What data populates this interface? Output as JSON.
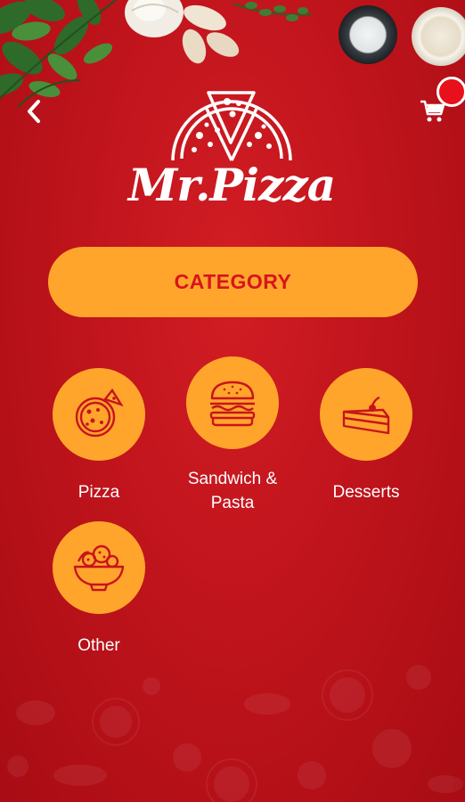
{
  "app": {
    "logo_text": "Mr.Pizza"
  },
  "header": {
    "back_icon": "chevron-left-icon",
    "cart_icon": "cart-icon"
  },
  "category_button": {
    "label": "CATEGORY"
  },
  "categories": [
    {
      "label": "Pizza",
      "icon": "pizza-icon"
    },
    {
      "label": "Sandwich & Pasta",
      "icon": "burger-icon"
    },
    {
      "label": "Desserts",
      "icon": "cake-icon"
    },
    {
      "label": "Other",
      "icon": "salad-bowl-icon"
    }
  ],
  "colors": {
    "background": "#c0141c",
    "accent": "#ffa52c",
    "accent_text": "#d8141c",
    "badge": "#e8101a"
  }
}
